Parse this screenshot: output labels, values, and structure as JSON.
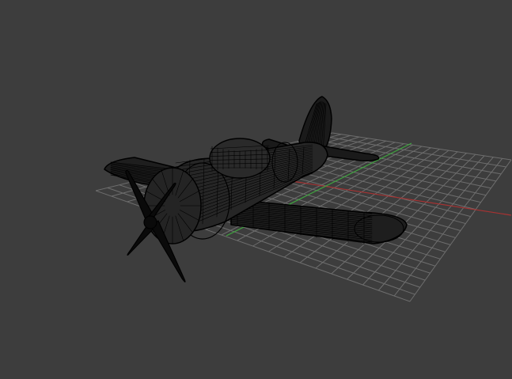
{
  "viewport": {
    "background_color": "#3d3d3d",
    "grid_color": "#6e6e6e",
    "x_axis_color": "#a83232",
    "z_axis_color": "#3fa83f",
    "shading_mode": "wireframe",
    "wire_color": "#000000",
    "model": "propeller-airplane"
  }
}
